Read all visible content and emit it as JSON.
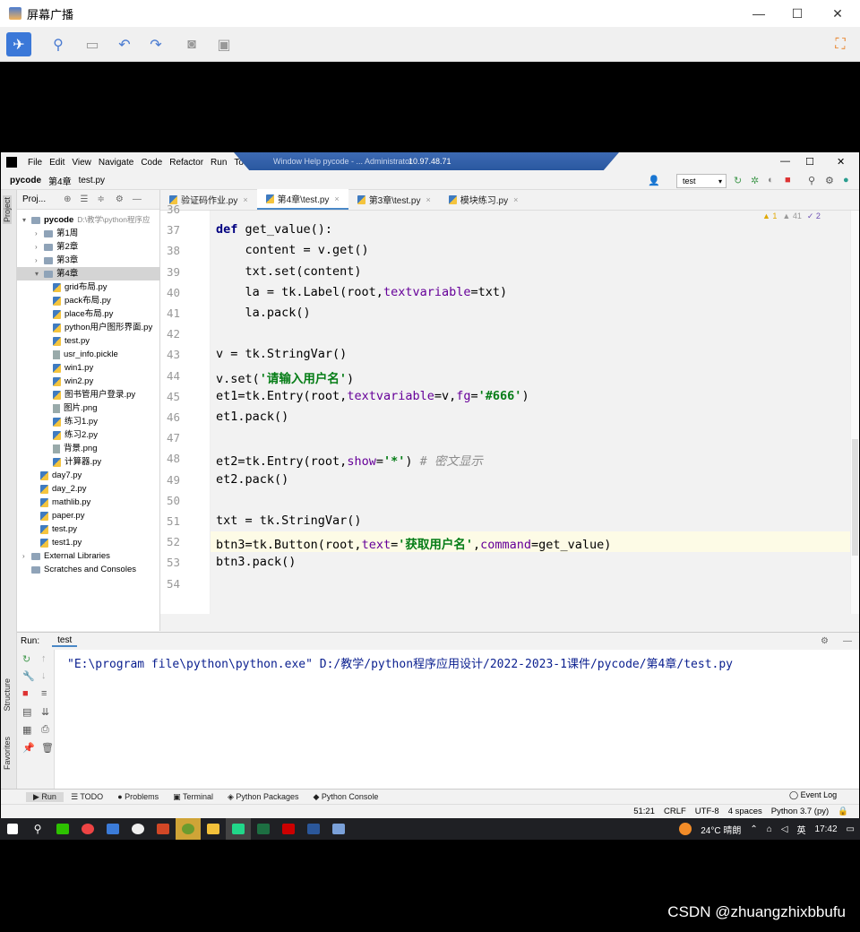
{
  "outer_window": {
    "title": "屏幕广播",
    "min_symbol": "—",
    "max_symbol": "☐",
    "close_symbol": "✕"
  },
  "ide": {
    "menu": [
      "File",
      "Edit",
      "View",
      "Navigate",
      "Code",
      "Refactor",
      "Run",
      "Tools"
    ],
    "remote_bar": {
      "ip": "10.97.48.71",
      "text": "Window   Help     pycode - ... Administrator"
    },
    "breadcrumb": [
      "pycode",
      "第4章",
      "test.py"
    ],
    "run_config": "test",
    "project_header": "Proj...",
    "tree": [
      {
        "label": "pycode",
        "extra": "D:\\教学\\python程序应",
        "level": 0,
        "type": "folder",
        "arrow": "▾"
      },
      {
        "label": "第1周",
        "level": 1,
        "type": "folder",
        "arrow": "›"
      },
      {
        "label": "第2章",
        "level": 1,
        "type": "folder",
        "arrow": "›"
      },
      {
        "label": "第3章",
        "level": 1,
        "type": "folder",
        "arrow": "›"
      },
      {
        "label": "第4章",
        "level": 1,
        "type": "folder",
        "arrow": "▾",
        "selected": true
      },
      {
        "label": "grid布局.py",
        "level": 2,
        "type": "py"
      },
      {
        "label": "pack布局.py",
        "level": 2,
        "type": "py"
      },
      {
        "label": "place布局.py",
        "level": 2,
        "type": "py"
      },
      {
        "label": "python用户图形界面.py",
        "level": 2,
        "type": "py"
      },
      {
        "label": "test.py",
        "level": 2,
        "type": "py"
      },
      {
        "label": "usr_info.pickle",
        "level": 2,
        "type": "file"
      },
      {
        "label": "win1.py",
        "level": 2,
        "type": "py"
      },
      {
        "label": "win2.py",
        "level": 2,
        "type": "py"
      },
      {
        "label": "图书管用户登录.py",
        "level": 2,
        "type": "py"
      },
      {
        "label": "图片.png",
        "level": 2,
        "type": "file"
      },
      {
        "label": "练习1.py",
        "level": 2,
        "type": "py"
      },
      {
        "label": "练习2.py",
        "level": 2,
        "type": "py"
      },
      {
        "label": "背景.png",
        "level": 2,
        "type": "file"
      },
      {
        "label": "计算器.py",
        "level": 2,
        "type": "py"
      },
      {
        "label": "day7.py",
        "level": 1,
        "type": "py"
      },
      {
        "label": "day_2.py",
        "level": 1,
        "type": "py"
      },
      {
        "label": "mathlib.py",
        "level": 1,
        "type": "py"
      },
      {
        "label": "paper.py",
        "level": 1,
        "type": "py"
      },
      {
        "label": "test.py",
        "level": 1,
        "type": "py"
      },
      {
        "label": "test1.py",
        "level": 1,
        "type": "py"
      },
      {
        "label": "External Libraries",
        "level": 0,
        "type": "folder",
        "arrow": "›"
      },
      {
        "label": "Scratches and Consoles",
        "level": 0,
        "type": "folder",
        "arrow": ""
      }
    ],
    "editor_tabs": [
      {
        "label": "验证码作业.py",
        "active": false
      },
      {
        "label": "第4章\\test.py",
        "active": true
      },
      {
        "label": "第3章\\test.py",
        "active": false
      },
      {
        "label": "模块练习.py",
        "active": false
      }
    ],
    "inspections": {
      "warn": "▲ 1",
      "weak": "▲ 41",
      "typo": "✓ 2"
    },
    "code_lines": [
      {
        "n": "36",
        "t": ""
      },
      {
        "n": "37",
        "t": "<span class='kw'>def</span> get_value():"
      },
      {
        "n": "38",
        "t": "    content = v.get()"
      },
      {
        "n": "39",
        "t": "    txt.set(content)"
      },
      {
        "n": "40",
        "t": "    la = tk.Label(root,<span class='kwarg'>textvariable</span>=txt)"
      },
      {
        "n": "41",
        "t": "    la.pack()"
      },
      {
        "n": "42",
        "t": ""
      },
      {
        "n": "43",
        "t": "v = tk.StringVar()"
      },
      {
        "n": "44",
        "t": "v.set(<span class='str'>'请输入用户名'</span>)"
      },
      {
        "n": "45",
        "t": "et1=tk.Entry(root,<span class='kwarg'>textvariable</span>=v,<span class='kwarg'>fg</span>=<span class='str'>'#666'</span>)"
      },
      {
        "n": "46",
        "t": "et1.pack()"
      },
      {
        "n": "47",
        "t": ""
      },
      {
        "n": "48",
        "t": "et2=tk.Entry(root,<span class='kwarg'>show</span>=<span class='str'>'*'</span>) <span class='cm'># 密文显示</span>"
      },
      {
        "n": "49",
        "t": "et2.pack()"
      },
      {
        "n": "50",
        "t": ""
      },
      {
        "n": "51",
        "t": "txt = tk.StringVar()"
      },
      {
        "n": "52",
        "t": "btn3=tk.Button(root,<span class='kwarg'>text</span>=<span class='str'>'获取用户名'</span>,<span class='kwarg'>command</span>=get_value)"
      },
      {
        "n": "53",
        "t": "btn3.pack()"
      },
      {
        "n": "54",
        "t": ""
      }
    ],
    "run": {
      "label": "Run:",
      "tab": "test",
      "console_output": "\"E:\\program file\\python\\python.exe\" D:/教学/python程序应用设计/2022-2023-1课件/pycode/第4章/test.py"
    },
    "bottom_tabs": [
      "▶ Run",
      "☰ TODO",
      "● Problems",
      "▣ Terminal",
      "◈ Python Packages",
      "◆ Python Console"
    ],
    "event_log": "◯ Event Log",
    "status": [
      "51:21",
      "CRLF",
      "UTF-8",
      "4 spaces",
      "Python 3.7 (py)"
    ],
    "side_tabs": {
      "project": "Project",
      "structure": "Structure",
      "favorites": "Favorites"
    }
  },
  "taskbar": {
    "weather": "24°C 晴朗",
    "lang": "英",
    "time": "17:42"
  },
  "watermark": "CSDN @zhuangzhixbbufu"
}
